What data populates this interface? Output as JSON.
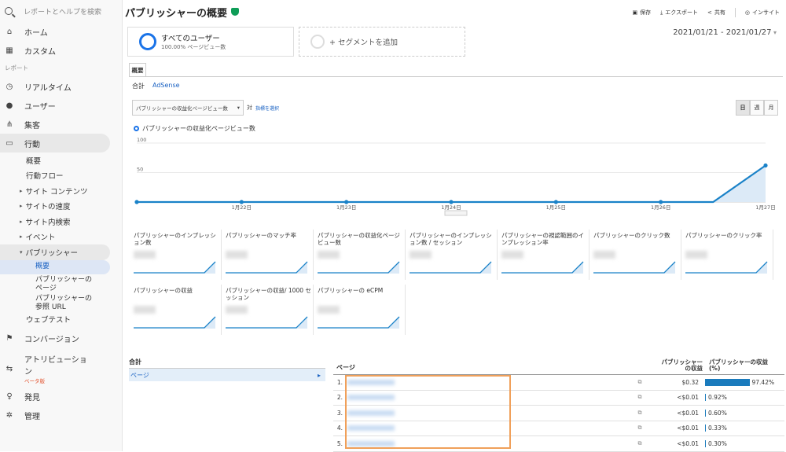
{
  "sidebar": {
    "search_placeholder": "レポートとヘルプを検索",
    "home": "ホーム",
    "custom": "カスタム",
    "section_reports": "レポート",
    "realtime": "リアルタイム",
    "users": "ユーザー",
    "acquisition": "集客",
    "behavior": "行動",
    "behavior_sub": {
      "overview": "概要",
      "flow": "行動フロー",
      "site_content": "サイト コンテンツ",
      "site_speed": "サイトの速度",
      "site_search": "サイト内検索",
      "events": "イベント",
      "publisher": "パブリッシャー",
      "publisher_overview": "概要",
      "publisher_pages_1": "パブリッシャーの",
      "publisher_pages_2": "ページ",
      "publisher_ref_1": "パブリッシャーの",
      "publisher_ref_2": "参照 URL",
      "web_test": "ウェブテスト"
    },
    "conversion": "コンバージョン",
    "attribution_1": "アトリビューショ",
    "attribution_2": "ン",
    "beta": "ベータ版",
    "discover": "発見",
    "admin": "管理"
  },
  "header": {
    "title": "パブリッシャーの概要",
    "save": "保存",
    "export": "エクスポート",
    "share": "共有",
    "insight": "インサイト"
  },
  "segments": {
    "all_users": "すべてのユーザー",
    "all_users_sub": "100.00% ページビュー数",
    "add_segment": "+ セグメントを追加"
  },
  "date_range": "2021/01/21 - 2021/01/27",
  "tabs": {
    "overview": "概要"
  },
  "subtabs": {
    "total": "合計",
    "adsense": "AdSense"
  },
  "controls": {
    "metric_select": "パブリッシャーの収益化ページビュー数",
    "vs": "対",
    "choose_metric": "指標を選択",
    "day": "日",
    "week": "週",
    "month": "月"
  },
  "chart_data": {
    "type": "line",
    "series": [
      {
        "name": "パブリッシャーの収益化ページビュー数",
        "values": [
          0,
          0,
          0,
          0,
          0,
          0,
          0,
          62
        ]
      }
    ],
    "x": [
      "",
      "1月22日",
      "1月23日",
      "1月24日",
      "1月25日",
      "1月26日",
      "",
      "1月27日"
    ],
    "x_index": [
      0,
      1,
      2,
      3,
      4,
      5,
      5.5,
      6
    ],
    "y_ticks": [
      "100",
      "50"
    ],
    "ylim": [
      0,
      100
    ],
    "grid": true,
    "color": "#1a82c8"
  },
  "metrics": [
    {
      "label": "パブリッシャーのインプレッション数"
    },
    {
      "label": "パブリッシャーのマッチ率"
    },
    {
      "label": "パブリッシャーの収益化ページビュー数"
    },
    {
      "label": "パブリッシャーのインプレッション数 / セッション"
    },
    {
      "label": "パブリッシャーの視認範囲のインプレッション率"
    },
    {
      "label": "パブリッシャーのクリック数"
    },
    {
      "label": "パブリッシャーのクリック率"
    },
    {
      "label": "パブリッシャーの収益"
    },
    {
      "label": "パブリッシャーの収益/ 1000 セッション"
    },
    {
      "label": "パブリッシャーの eCPM"
    }
  ],
  "table_left": {
    "header": "合計",
    "row": "ページ"
  },
  "table_right": {
    "col_page": "ページ",
    "col_revenue_1": "パブリッシャー",
    "col_revenue_2": "の収益",
    "col_pct_1": "パブリッシャーの収益",
    "col_pct_2": "(%)",
    "rows": [
      {
        "num": "1.",
        "revenue": "$0.32",
        "pct": "97.42%",
        "pct_value": 97.42
      },
      {
        "num": "2.",
        "revenue": "<$0.01",
        "pct": "0.92%",
        "pct_value": 0.92
      },
      {
        "num": "3.",
        "revenue": "<$0.01",
        "pct": "0.60%",
        "pct_value": 0.6
      },
      {
        "num": "4.",
        "revenue": "<$0.01",
        "pct": "0.33%",
        "pct_value": 0.33
      },
      {
        "num": "5.",
        "revenue": "<$0.01",
        "pct": "0.30%",
        "pct_value": 0.3
      }
    ]
  }
}
